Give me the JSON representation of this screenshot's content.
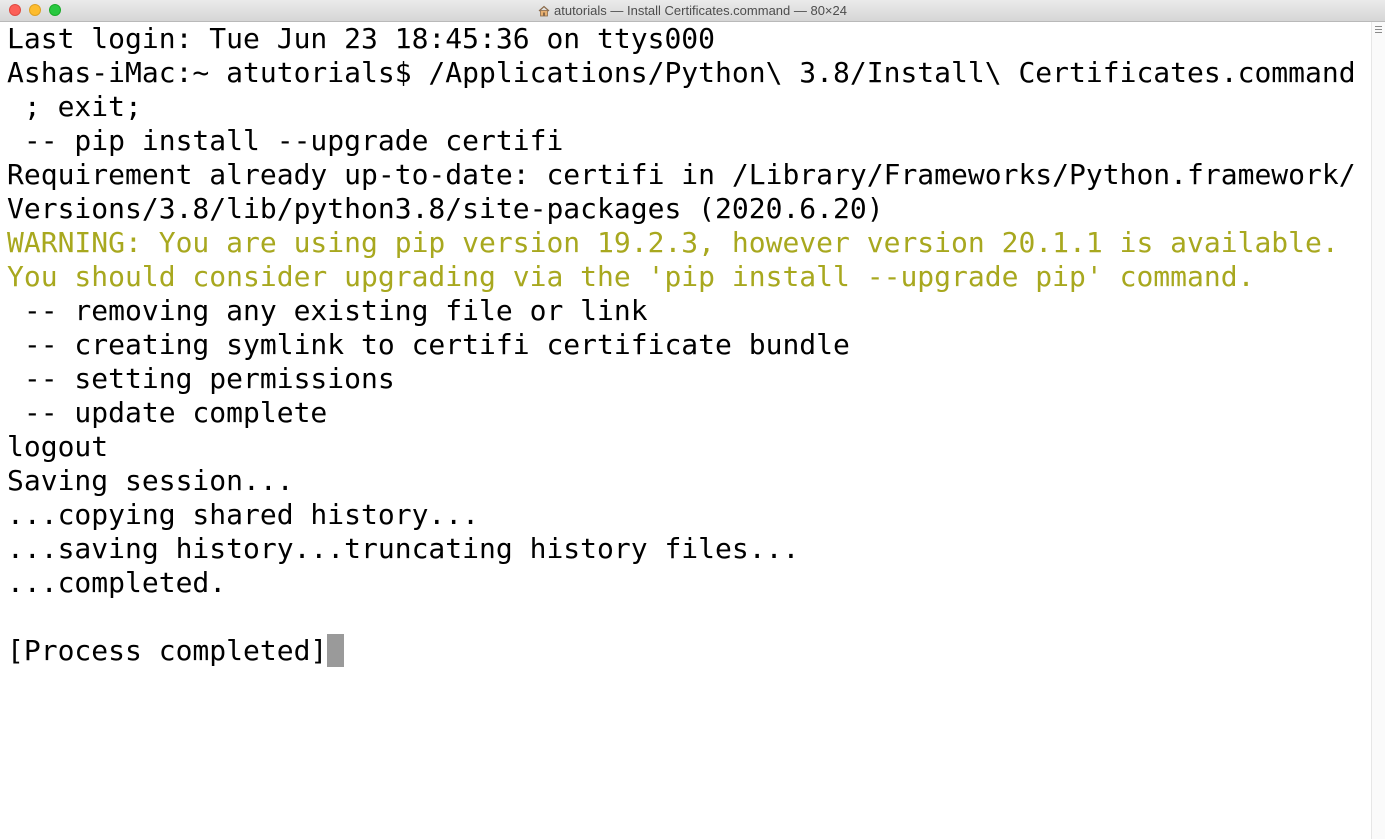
{
  "window": {
    "title": "atutorials — Install Certificates.command — 80×24",
    "icon": "home-icon",
    "colors": {
      "close": "#fc5f57",
      "minimize": "#fdbc2e",
      "zoom": "#28c840",
      "warning_text": "#a8a81f",
      "cursor": "#9a9a9a"
    }
  },
  "terminal": {
    "lines": [
      "Last login: Tue Jun 23 18:45:36 on ttys000",
      "Ashas-iMac:~ atutorials$ /Applications/Python\\ 3.8/Install\\ Certificates.command",
      " ; exit;",
      " -- pip install --upgrade certifi",
      "Requirement already up-to-date: certifi in /Library/Frameworks/Python.framework/",
      "Versions/3.8/lib/python3.8/site-packages (2020.6.20)",
      "WARNING: You are using pip version 19.2.3, however version 20.1.1 is available.",
      "You should consider upgrading via the 'pip install --upgrade pip' command.",
      " -- removing any existing file or link",
      " -- creating symlink to certifi certificate bundle",
      " -- setting permissions",
      " -- update complete",
      "logout",
      "Saving session...",
      "...copying shared history...",
      "...saving history...truncating history files...",
      "...completed.",
      "",
      "[Process completed]"
    ]
  }
}
